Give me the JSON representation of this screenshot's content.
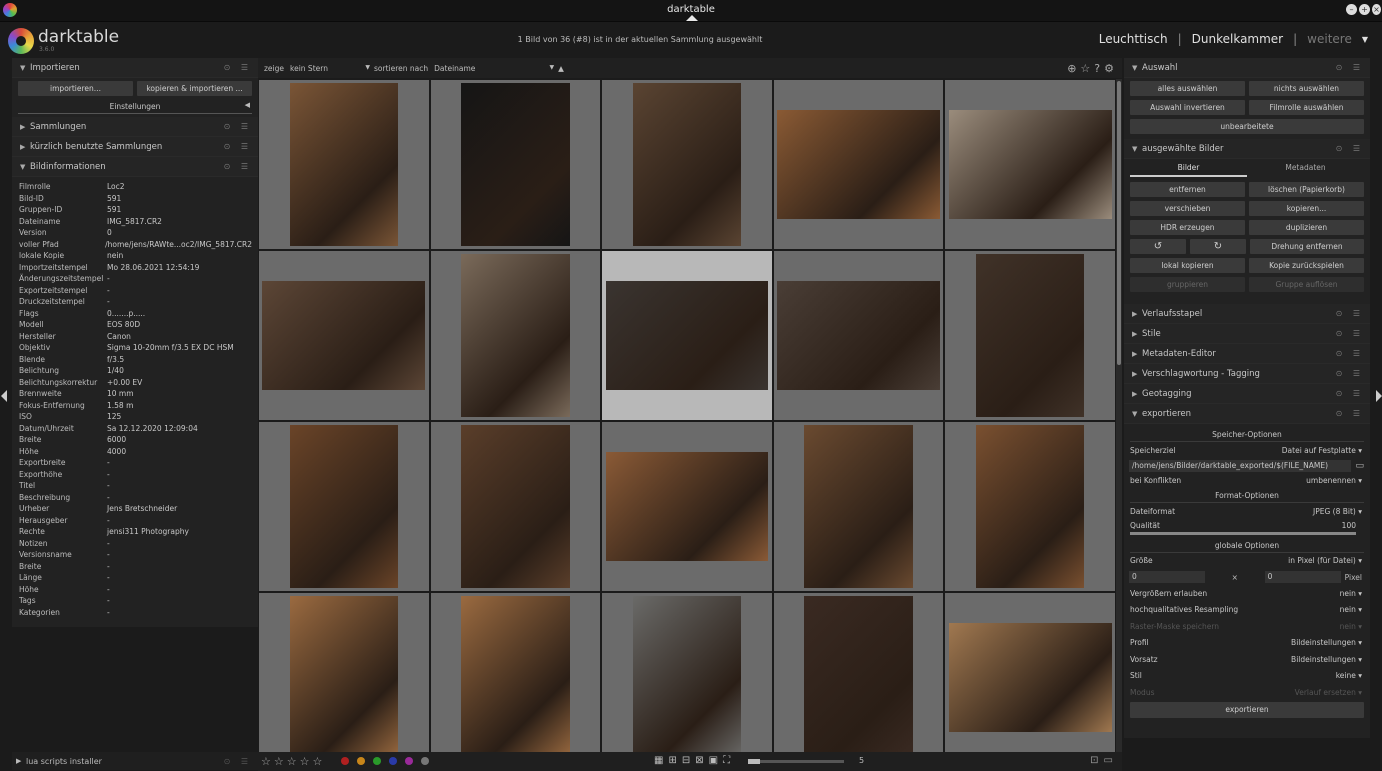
{
  "window": {
    "title": "darktable"
  },
  "header": {
    "logo_text": "darktable",
    "version": "3.6.0",
    "info": "1 Bild von 36 (#8) ist in der aktuellen Sammlung ausgewählt",
    "views": [
      "Leuchttisch",
      "Dunkelkammer",
      "weitere"
    ]
  },
  "left": {
    "import_title": "Importieren",
    "import_btn": "importieren...",
    "copy_import_btn": "kopieren & importieren ...",
    "settings": "Einstellungen",
    "collections": "Sammlungen",
    "recent": "kürzlich benutzte Sammlungen",
    "image_info": "Bildinformationen",
    "info_rows": [
      [
        "Filmrolle",
        "Loc2"
      ],
      [
        "Bild-ID",
        "591"
      ],
      [
        "Gruppen-ID",
        "591"
      ],
      [
        "Dateiname",
        "IMG_5817.CR2"
      ],
      [
        "Version",
        "0"
      ],
      [
        "voller Pfad",
        "/home/jens/RAWte...oc2/IMG_5817.CR2"
      ],
      [
        "lokale Kopie",
        "nein"
      ],
      [
        "Importzeitstempel",
        "Mo 28.06.2021 12:54:19"
      ],
      [
        "Änderungszeitstempel",
        "-"
      ],
      [
        "Exportzeitstempel",
        "-"
      ],
      [
        "Druckzeitstempel",
        "-"
      ],
      [
        "Flags",
        "0.......p....."
      ],
      [
        "Modell",
        "EOS 80D"
      ],
      [
        "Hersteller",
        "Canon"
      ],
      [
        "Objektiv",
        "Sigma 10-20mm f/3.5 EX DC HSM"
      ],
      [
        "Blende",
        "f/3.5"
      ],
      [
        "Belichtung",
        "1/40"
      ],
      [
        "Belichtungskorrektur",
        "+0.00 EV"
      ],
      [
        "Brennweite",
        "10 mm"
      ],
      [
        "Fokus-Entfernung",
        "1.58 m"
      ],
      [
        "ISO",
        "125"
      ],
      [
        "Datum/Uhrzeit",
        "Sa 12.12.2020 12:09:04"
      ],
      [
        "Breite",
        "6000"
      ],
      [
        "Höhe",
        "4000"
      ],
      [
        "Exportbreite",
        "-"
      ],
      [
        "Exporthöhe",
        "-"
      ],
      [
        "Titel",
        "-"
      ],
      [
        "Beschreibung",
        "-"
      ],
      [
        "Urheber",
        "Jens Bretschneider"
      ],
      [
        "Herausgeber",
        "-"
      ],
      [
        "Rechte",
        "jensi311 Photography"
      ],
      [
        "Notizen",
        "-"
      ],
      [
        "Versionsname",
        "-"
      ],
      [
        "Breite",
        "-"
      ],
      [
        "Länge",
        "-"
      ],
      [
        "Höhe",
        "-"
      ],
      [
        "Tags",
        "-"
      ],
      [
        "Kategorien",
        "-"
      ]
    ],
    "lua": "lua scripts installer"
  },
  "toolbar": {
    "show": "zeige",
    "filter": "kein Stern",
    "sort_label": "sortieren nach",
    "sort_value": "Dateiname"
  },
  "thumbnails": [
    {
      "color": "#7a5536"
    },
    {
      "color": "#151515"
    },
    {
      "color": "#5a4432"
    },
    {
      "color": "#8a5a34"
    },
    {
      "color": "#9a8c7c"
    },
    {
      "color": "#5c4636"
    },
    {
      "color": "#7a6a5a"
    },
    {
      "color": "#3a3430"
    },
    {
      "color": "#4a3e36"
    },
    {
      "color": "#403228"
    },
    {
      "color": "#6a4428"
    },
    {
      "color": "#5a3e2a"
    },
    {
      "color": "#8a5a36"
    },
    {
      "color": "#6a4a30"
    },
    {
      "color": "#7a5030"
    },
    {
      "color": "#9a6a40"
    },
    {
      "color": "#9a6a40"
    },
    {
      "color": "#6a6a68"
    },
    {
      "color": "#3a2a22"
    },
    {
      "color": "#a07850"
    }
  ],
  "bottom": {
    "zoom_value": "5"
  },
  "right": {
    "selection": "Auswahl",
    "sel_btns": [
      "alles auswählen",
      "nichts auswählen",
      "Auswahl invertieren",
      "Filmrolle auswählen"
    ],
    "unedited": "unbearbeitete",
    "selected_images": "ausgewählte Bilder",
    "tabs": [
      "Bilder",
      "Metadaten"
    ],
    "img_btns": [
      "entfernen",
      "löschen (Papierkorb)",
      "verschieben",
      "kopieren...",
      "HDR erzeugen",
      "duplizieren"
    ],
    "rotate_left": "↺",
    "rotate_right": "↻",
    "remove_rotation": "Drehung entfernen",
    "img_btns2": [
      "lokal kopieren",
      "Kopie zurückspielen",
      "gruppieren",
      "Gruppe auflösen"
    ],
    "modules": [
      "Verlaufsstapel",
      "Stile",
      "Metadaten-Editor",
      "Verschlagwortung - Tagging",
      "Geotagging"
    ],
    "export": "exportieren",
    "storage_opts": "Speicher-Optionen",
    "target_label": "Speicherziel",
    "target_value": "Datei auf Festplatte",
    "path": "/home/jens/Bilder/darktable_exported/$(FILE_NAME)",
    "conflict_label": "bei Konflikten",
    "conflict_value": "umbenennen",
    "format_opts": "Format-Optionen",
    "format_label": "Dateiformat",
    "format_value": "JPEG (8 Bit)",
    "quality_label": "Qualität",
    "quality_value": "100",
    "global_opts": "globale Optionen",
    "size_label": "Größe",
    "size_value": "in Pixel (für Datei)",
    "width_val": "0",
    "x_sym": "×",
    "height_val": "0",
    "pixel": "Pixel",
    "upscale_label": "Vergrößern erlauben",
    "upscale_value": "nein",
    "hq_label": "hochqualitatives Resampling",
    "hq_value": "nein",
    "mask_label": "Raster-Maske speichern",
    "mask_value": "nein",
    "profile_label": "Profil",
    "profile_value": "Bildeinstellungen",
    "intent_label": "Vorsatz",
    "intent_value": "Bildeinstellungen",
    "style_label": "Stil",
    "style_value": "keine",
    "mode_label": "Modus",
    "mode_value": "Verlauf ersetzen",
    "export_btn": "exportieren"
  }
}
